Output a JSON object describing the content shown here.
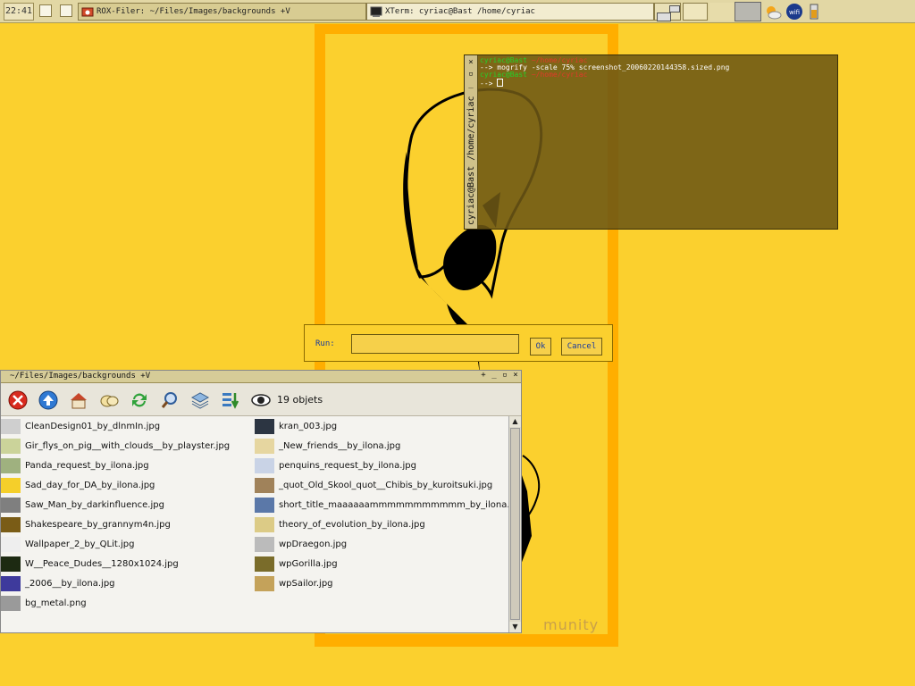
{
  "taskbar": {
    "clock": "22:41",
    "tasks": [
      {
        "label": "ROX-Filer: ~/Files/Images/backgrounds +V",
        "icon": "rox-filer-icon"
      },
      {
        "label": "XTerm: cyriac@Bast /home/cyriac",
        "icon": "terminal-icon"
      }
    ],
    "tray_icons": [
      "weather-icon",
      "wifi-icon",
      "battery-icon"
    ]
  },
  "wallpaper": {
    "text": "munity",
    "colors": {
      "background": "#fbd02e",
      "frame": "#ffae00"
    }
  },
  "xterm": {
    "side_title": "cyriac@Bast /home/cyriac",
    "lines": [
      {
        "user": "cyriac@Bast",
        "path": "~/home/cyriac",
        "cmd": ""
      },
      {
        "prefix": "-->",
        "cmd": "mogrify -scale 75% screenshot_20060220144358.sized.png"
      },
      {
        "user": "cyriac@Bast",
        "path": "~/home/cyriac",
        "cmd": ""
      },
      {
        "prefix": "-->",
        "cmd": ""
      }
    ]
  },
  "run_dialog": {
    "label": "Run:",
    "value": "",
    "ok_label": "Ok",
    "cancel_label": "Cancel"
  },
  "rox": {
    "title": "~/Files/Images/backgrounds +V",
    "count": "19 objets",
    "toolbar_icons": [
      "close-icon",
      "up-icon",
      "home-icon",
      "bookmarks-icon",
      "refresh-icon",
      "zoom-icon",
      "layers-icon",
      "sort-icon",
      "eye-icon"
    ],
    "files_left": [
      "CleanDesign01_by_dlnmIn.jpg",
      "Gir_flys_on_pig__with_clouds__by_playster.jpg",
      "Panda_request_by_ilona.jpg",
      "Sad_day_for_DA_by_ilona.jpg",
      "Saw_Man_by_darkinfluence.jpg",
      "Shakespeare_by_grannym4n.jpg",
      "Wallpaper_2_by_QLit.jpg",
      "W__Peace_Dudes__1280x1024.jpg",
      "_2006__by_ilona.jpg",
      "bg_metal.png"
    ],
    "files_right": [
      "kran_003.jpg",
      "_New_friends__by_ilona.jpg",
      "penquins_request_by_ilona.jpg",
      "_quot_Old_Skool_quot__Chibis_by_kuroitsuki.jpg",
      "short_title_maaaaaammmmmmmmmmm_by_ilona.j",
      "theory_of_evolution_by_ilona.jpg",
      "wpDraegon.jpg",
      "wpGorilla.jpg",
      "wpSailor.jpg"
    ],
    "thumb_colors_left": [
      "#cfcfcf",
      "#cbd39a",
      "#9fb17f",
      "#f5cf2a",
      "#7f7f7f",
      "#7a5c16",
      "#eeeeee",
      "#1d2a12",
      "#3e3a9c",
      "#9a9a9a"
    ],
    "thumb_colors_right": [
      "#2c3542",
      "#e6d6a0",
      "#c9d3e6",
      "#a0825a",
      "#5b78a8",
      "#dccb86",
      "#bbbbbb",
      "#7a6c2a",
      "#c4a25a"
    ]
  }
}
